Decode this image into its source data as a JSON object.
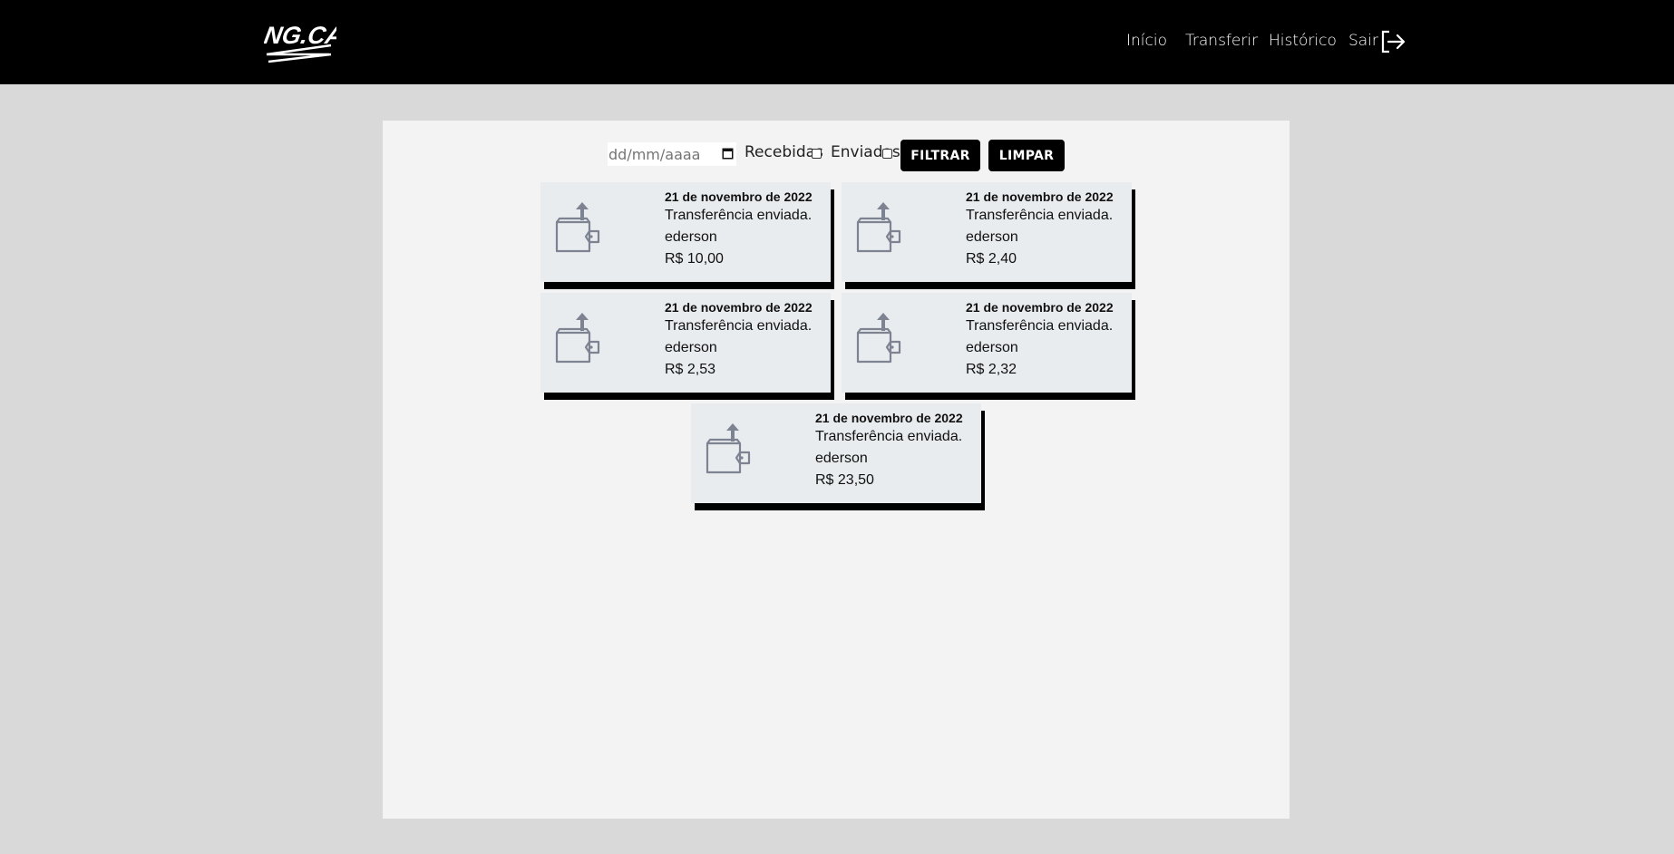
{
  "brand": {
    "logo_text": "NG.CA$H"
  },
  "nav": {
    "items": [
      {
        "label": "Início"
      },
      {
        "label": "Transferir"
      },
      {
        "label": "Histórico"
      },
      {
        "label": "Sair"
      }
    ]
  },
  "filters": {
    "date_placeholder": "dd/mm/aaaa",
    "received_label": "Recebidas",
    "received_checked": false,
    "sent_label": "Enviadas",
    "sent_checked": false,
    "filter_button": "FILTRAR",
    "clear_button": "LIMPAR"
  },
  "transactions": [
    {
      "date": "21 de novembro de 2022",
      "type": "Transferência enviada.",
      "user": "ederson",
      "amount": "R$ 10,00",
      "icon": "wallet-send-icon"
    },
    {
      "date": "21 de novembro de 2022",
      "type": "Transferência enviada.",
      "user": "ederson",
      "amount": "R$ 2,40",
      "icon": "wallet-send-icon"
    },
    {
      "date": "21 de novembro de 2022",
      "type": "Transferência enviada.",
      "user": "ederson",
      "amount": "R$ 2,53",
      "icon": "wallet-send-icon"
    },
    {
      "date": "21 de novembro de 2022",
      "type": "Transferência enviada.",
      "user": "ederson",
      "amount": "R$ 2,32",
      "icon": "wallet-send-icon"
    },
    {
      "date": "21 de novembro de 2022",
      "type": "Transferência enviada.",
      "user": "ederson",
      "amount": "R$ 23,50",
      "icon": "wallet-send-icon"
    }
  ],
  "colors": {
    "header_bg": "#000000",
    "page_bg": "#d9d9d9",
    "panel_bg": "#f3f3f3",
    "card_bg": "#e9ecef",
    "icon": "#7d8391"
  }
}
